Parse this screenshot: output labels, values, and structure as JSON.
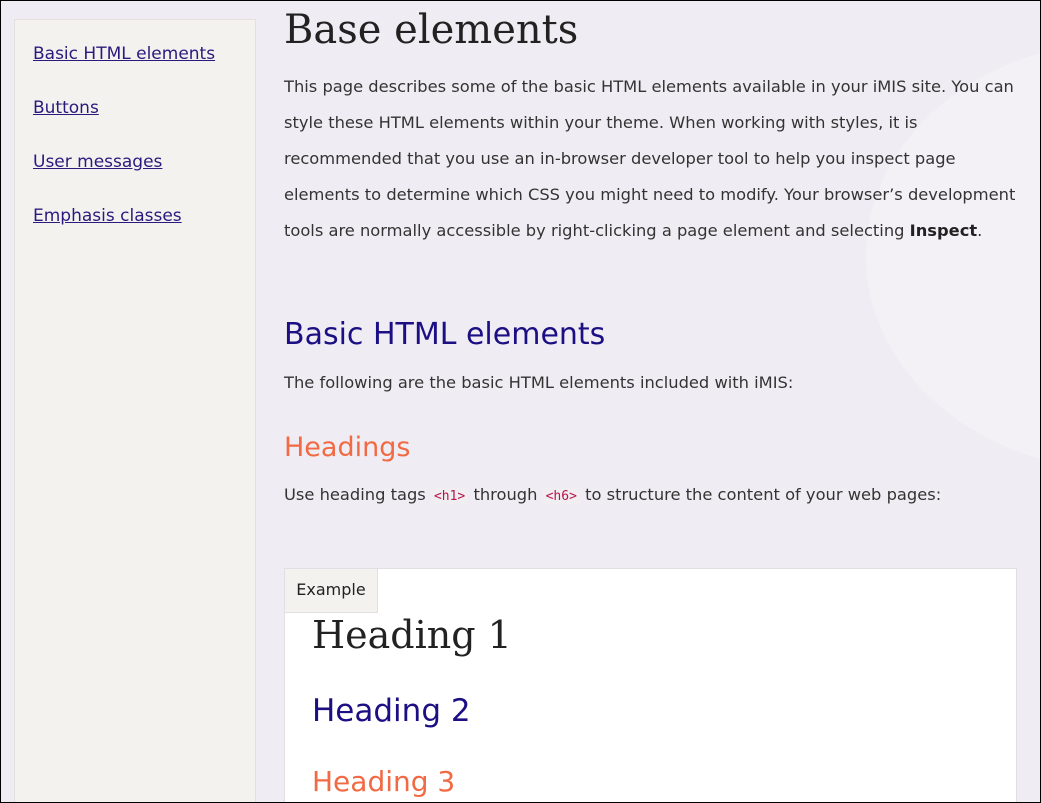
{
  "sidebar": {
    "items": [
      {
        "label": "Basic HTML elements"
      },
      {
        "label": "Buttons"
      },
      {
        "label": "User messages"
      },
      {
        "label": "Emphasis classes"
      }
    ]
  },
  "page": {
    "title": "Base elements",
    "intro_text": "This page describes some of the basic HTML elements available in your iMIS site. You can style these HTML elements within your theme. When working with styles, it is recommended that you use an in-browser developer tool to help you inspect page elements to determine which CSS you might need to modify. Your browser’s development tools are normally accessible by right-clicking a page element and selecting ",
    "intro_bold": "Inspect",
    "intro_end": "."
  },
  "section": {
    "heading": "Basic HTML elements",
    "text": "The following are the basic HTML elements included with iMIS:"
  },
  "subsection": {
    "heading": "Headings",
    "text_before": "Use heading tags ",
    "code1": "<h1>",
    "text_middle": " through ",
    "code2": "<h6>",
    "text_after": " to structure the content of your web pages:"
  },
  "example": {
    "tab_label": "Example",
    "h1": "Heading 1",
    "h2": "Heading 2",
    "h3": "Heading 3"
  },
  "colors": {
    "link": "#2a1a7d",
    "h2": "#1c0f84",
    "h3": "#f26a43",
    "code": "#b5154b",
    "background": "#efedf3",
    "sidebar_bg": "#f4f2ef"
  }
}
